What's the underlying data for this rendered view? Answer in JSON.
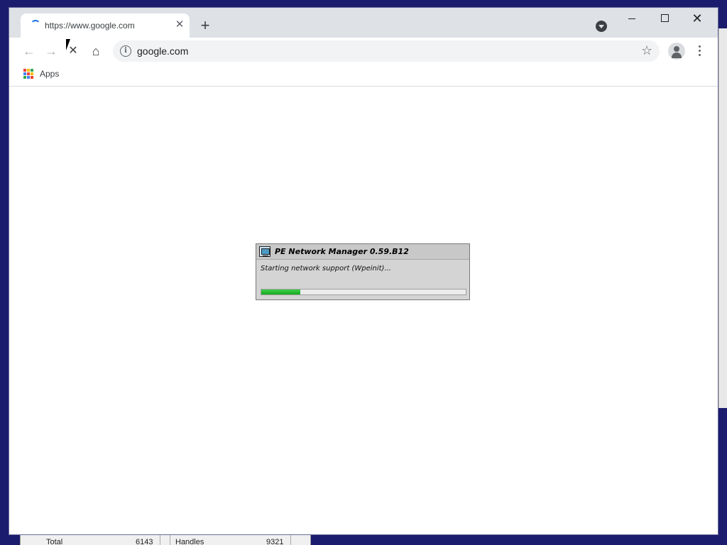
{
  "background_window": {
    "cells": [
      "Total",
      "6143",
      "Handles",
      "9321"
    ]
  },
  "browser": {
    "tab": {
      "title": "https://www.google.com",
      "close_glyph": "✕"
    },
    "new_tab_glyph": "+",
    "window_controls": {
      "close_glyph": "✕"
    },
    "toolbar": {
      "back_glyph": "←",
      "forward_glyph": "→",
      "stop_glyph": "✕",
      "home_glyph": "⌂",
      "omnibox": {
        "info_glyph": "i",
        "url": "google.com",
        "star_glyph": "☆"
      }
    },
    "bookmarks": {
      "apps_label": "Apps",
      "apps_colors": [
        "#ea4335",
        "#fbbc04",
        "#34a853",
        "#4285f4",
        "#ea4335",
        "#fbbc04",
        "#34a853",
        "#4285f4",
        "#ea4335"
      ]
    }
  },
  "dialog": {
    "title": "PE Network Manager 0.59.B12",
    "status": "Starting network support (Wpeinit)...",
    "progress": 0.19,
    "progress_color": "#1fbe2a"
  }
}
